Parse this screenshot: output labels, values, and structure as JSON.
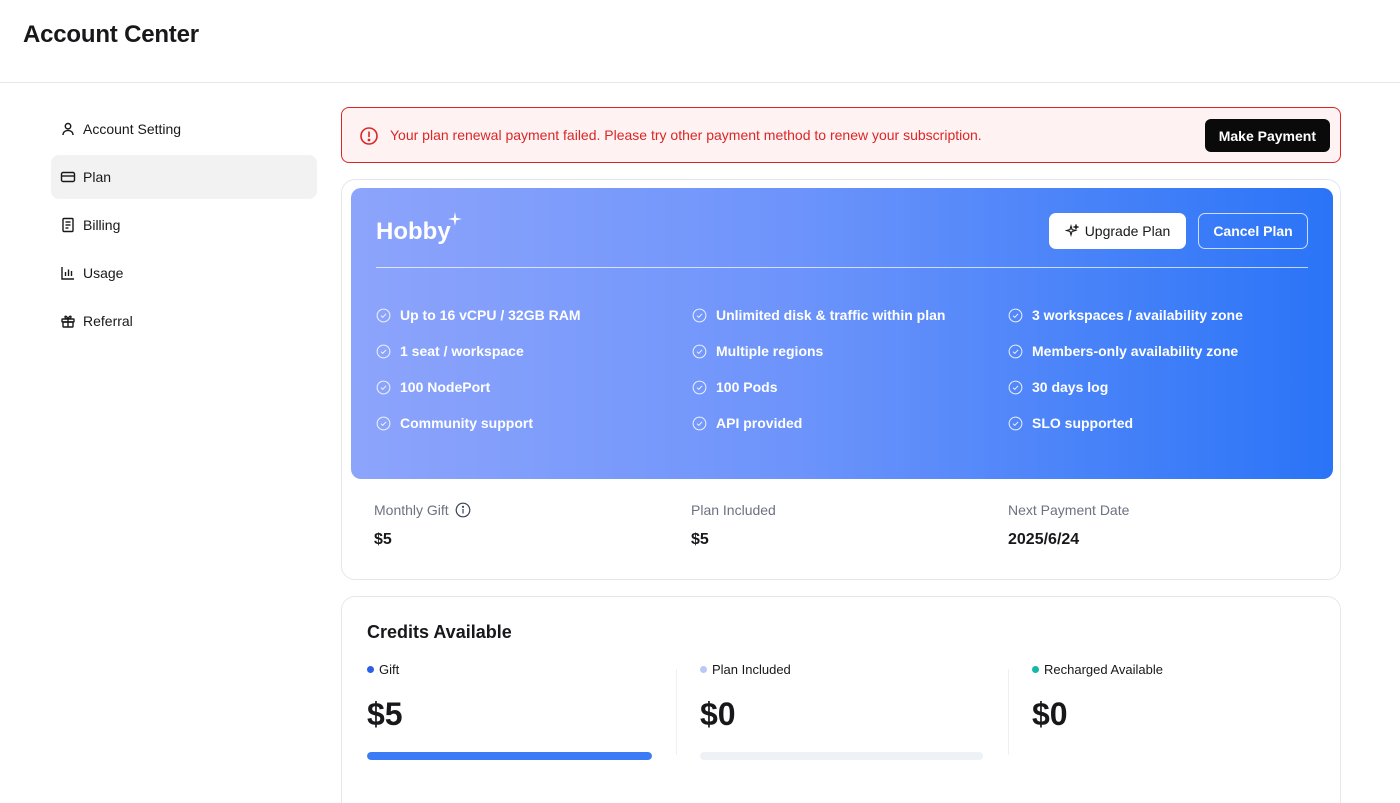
{
  "header": {
    "title": "Account Center"
  },
  "sidebar": {
    "items": [
      {
        "label": "Account Setting",
        "icon": "user-icon",
        "active": false
      },
      {
        "label": "Plan",
        "icon": "credit-card-icon",
        "active": true
      },
      {
        "label": "Billing",
        "icon": "receipt-icon",
        "active": false
      },
      {
        "label": "Usage",
        "icon": "bar-chart-icon",
        "active": false
      },
      {
        "label": "Referral",
        "icon": "gift-icon",
        "active": false
      }
    ]
  },
  "alert": {
    "message": "Your plan renewal payment failed. Please try other payment method to renew your subscription.",
    "button": "Make Payment",
    "color": "#dc2626"
  },
  "plan": {
    "name": "Hobby",
    "upgrade_label": "Upgrade Plan",
    "cancel_label": "Cancel Plan",
    "features": [
      "Up to 16 vCPU / 32GB RAM",
      "Unlimited disk & traffic within plan",
      "3 workspaces / availability zone",
      "1 seat / workspace",
      "Multiple regions",
      "Members-only availability zone",
      "100 NodePort",
      "100 Pods",
      "30 days log",
      "Community support",
      "API provided",
      "SLO supported"
    ],
    "stats": {
      "monthly_gift": {
        "label": "Monthly Gift",
        "value": "$5"
      },
      "plan_included": {
        "label": "Plan Included",
        "value": "$5"
      },
      "next_payment": {
        "label": "Next Payment Date",
        "value": "2025/6/24"
      }
    }
  },
  "credits": {
    "title": "Credits Available",
    "items": [
      {
        "label": "Gift",
        "amount": "$5",
        "color": "#2c5fe8",
        "bar_color": "#3b7cf6",
        "fill": 1.0
      },
      {
        "label": "Plan Included",
        "amount": "$0",
        "color": "#b9c8f7",
        "bar_color": "#b9c8f7",
        "fill": 0.0
      },
      {
        "label": "Recharged Available",
        "amount": "$0",
        "color": "#14b8a6",
        "bar_color": "#14b8a6",
        "fill": 0.0
      }
    ]
  }
}
